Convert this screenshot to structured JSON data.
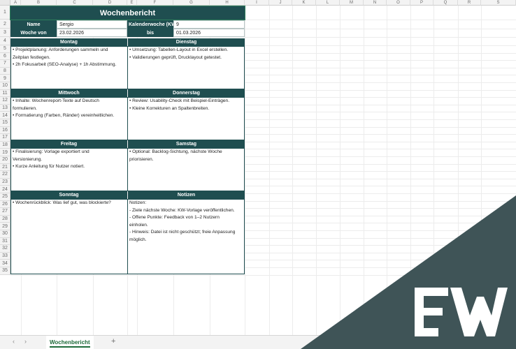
{
  "columns": [
    "A",
    "B",
    "C",
    "D",
    "E",
    "F",
    "G",
    "H",
    "I",
    "J",
    "K",
    "L",
    "M",
    "N",
    "O",
    "P",
    "Q",
    "R",
    "S"
  ],
  "rows": [
    "1",
    "2",
    "3",
    "4",
    "5",
    "6",
    "7",
    "8",
    "9",
    "10",
    "11",
    "12",
    "13",
    "14",
    "15",
    "16",
    "17",
    "18",
    "19",
    "20",
    "21",
    "22",
    "23",
    "24",
    "25",
    "26",
    "27",
    "28",
    "29",
    "30",
    "31",
    "32",
    "33",
    "34",
    "35"
  ],
  "report": {
    "title": "Wochenbericht",
    "name_label": "Name",
    "name_value": "Sergio",
    "kw_label": "Kalenderwoche (KW)",
    "kw_value": "9",
    "week_from_label": "Woche von",
    "week_from_value": "23.02.2026",
    "week_to_label": "bis",
    "week_to_value": "01.03.2026"
  },
  "days": {
    "montag": {
      "label": "Montag",
      "lines": [
        "• Projektplanung: Anforderungen sammeln und\nZeitplan festlegen.",
        "• 2h Fokusarbeit (SEO-Analyse) + 1h Abstimmung."
      ]
    },
    "dienstag": {
      "label": "Dienstag",
      "lines": [
        "• Umsetzung: Tabellen-Layout in Excel erstellen.",
        "• Validierungen geprüft, Drucklayout getestet."
      ]
    },
    "mittwoch": {
      "label": "Mittwoch",
      "lines": [
        "• Inhalte: Wochenreport-Texte auf Deutsch\nformulieren.",
        "• Formatierung (Farben, Ränder) vereinheitlichen."
      ]
    },
    "donnerstag": {
      "label": "Donnerstag",
      "lines": [
        "• Review: Usability-Check mit Beispiel-Einträgen.",
        "• Kleine Korrekturen an Spaltenbreiten."
      ]
    },
    "freitag": {
      "label": "Freitag",
      "lines": [
        "• Finalisierung: Vorlage exportiert und\nVersionierung.",
        "• Kurze Anleitung für Nutzer notiert."
      ]
    },
    "samstag": {
      "label": "Samstag",
      "lines": [
        "• Optional: Backlog-Sichtung, nächste Woche\npriorisieren."
      ]
    },
    "sonntag": {
      "label": "Sonntag",
      "lines": [
        "• Wochenrückblick: Was lief gut, was blockierte?"
      ]
    },
    "notizen": {
      "label": "Notizen",
      "lines": [
        "Notizen:",
        "- Ziele nächste Woche: KW-Vorlage veröffentlichen.",
        "- Offene Punkte: Feedback von 1–2 Nutzern\neinholen.",
        "- Hinweis: Datei ist nicht geschützt; freie Anpassung\nmöglich."
      ]
    }
  },
  "tabbar": {
    "prev_icon": "‹",
    "next_icon": "›",
    "sheet_tab": "Wochenbericht",
    "add_sheet": "+"
  },
  "brand": {
    "logo": "EW",
    "accent": "#1f4e50",
    "logo_band": "#3f5457"
  }
}
